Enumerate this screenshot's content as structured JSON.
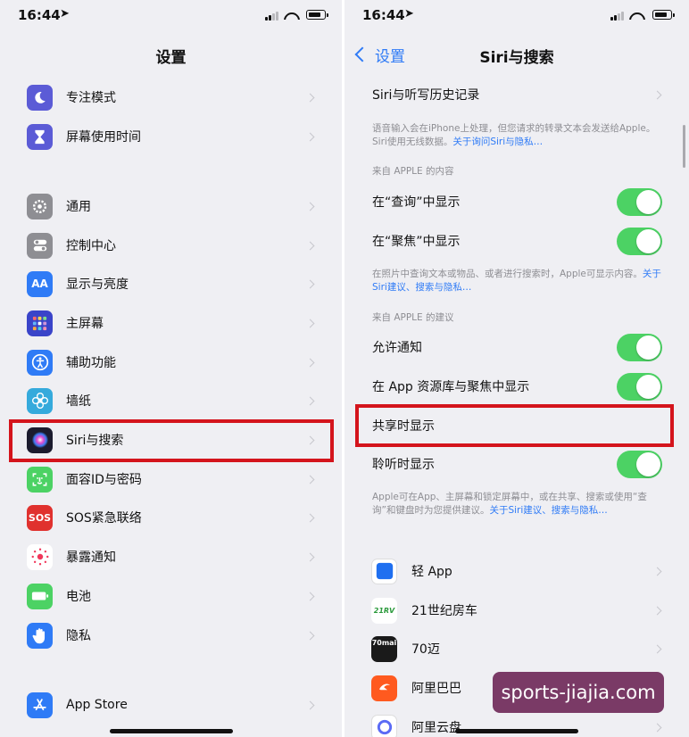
{
  "status_bar": {
    "time": "16:44"
  },
  "left": {
    "title": "设置",
    "items": [
      {
        "label": "专注模式"
      },
      {
        "label": "屏幕使用时间"
      },
      {
        "label": "通用"
      },
      {
        "label": "控制中心"
      },
      {
        "label": "显示与亮度"
      },
      {
        "label": "主屏幕"
      },
      {
        "label": "辅助功能"
      },
      {
        "label": "墙纸"
      },
      {
        "label": "Siri与搜索"
      },
      {
        "label": "面容ID与密码"
      },
      {
        "label": "SOS紧急联络"
      },
      {
        "label": "暴露通知"
      },
      {
        "label": "电池"
      },
      {
        "label": "隐私"
      },
      {
        "label": "App Store"
      }
    ],
    "icon_text": {
      "display": "AA",
      "sos": "SOS"
    }
  },
  "right": {
    "back_label": "设置",
    "title": "Siri与搜索",
    "history_label": "Siri与听写历史记录",
    "history_note": "语音输入会在iPhone上处理，但您请求的转录文本会发送给Apple。Siri使用无线数据。",
    "history_link": "关于询问Siri与隐私…",
    "section_content": "来自 APPLE 的内容",
    "show_in_lookup": "在“查询”中显示",
    "show_in_spotlight": "在“聚焦”中显示",
    "content_note": "在照片中查询文本或物品、或者进行搜索时，Apple可显示内容。",
    "content_link": "关于Siri建议、搜索与隐私…",
    "section_suggestions": "来自 APPLE 的建议",
    "allow_notifications": "允许通知",
    "show_in_library": "在 App 资源库与聚焦中显示",
    "show_when_sharing": "共享时显示",
    "show_when_listening": "聆听时显示",
    "suggestions_note": "Apple可在App、主屏幕和锁定屏幕中，或在共享、搜索或使用“查询”和键盘时为您提供建议。",
    "suggestions_link": "关于Siri建议、搜索与隐私…",
    "apps": [
      {
        "label": "轻 App"
      },
      {
        "label": "21世纪房车"
      },
      {
        "label": "70迈"
      },
      {
        "label": "阿里巴巴"
      },
      {
        "label": "阿里云盘"
      }
    ],
    "app_icon_text": {
      "rv": "21RV",
      "mai": "70mai"
    }
  },
  "toggles": {
    "show_in_lookup": true,
    "show_in_spotlight": true,
    "allow_notifications": true,
    "show_in_library": true,
    "show_when_listening": true
  },
  "watermark": "sports-jiajia.com",
  "colors": {
    "accent": "#2f7bf6",
    "toggle_on": "#4cd264",
    "highlight": "#d4141c",
    "watermark_bg": "#7a3a66"
  }
}
